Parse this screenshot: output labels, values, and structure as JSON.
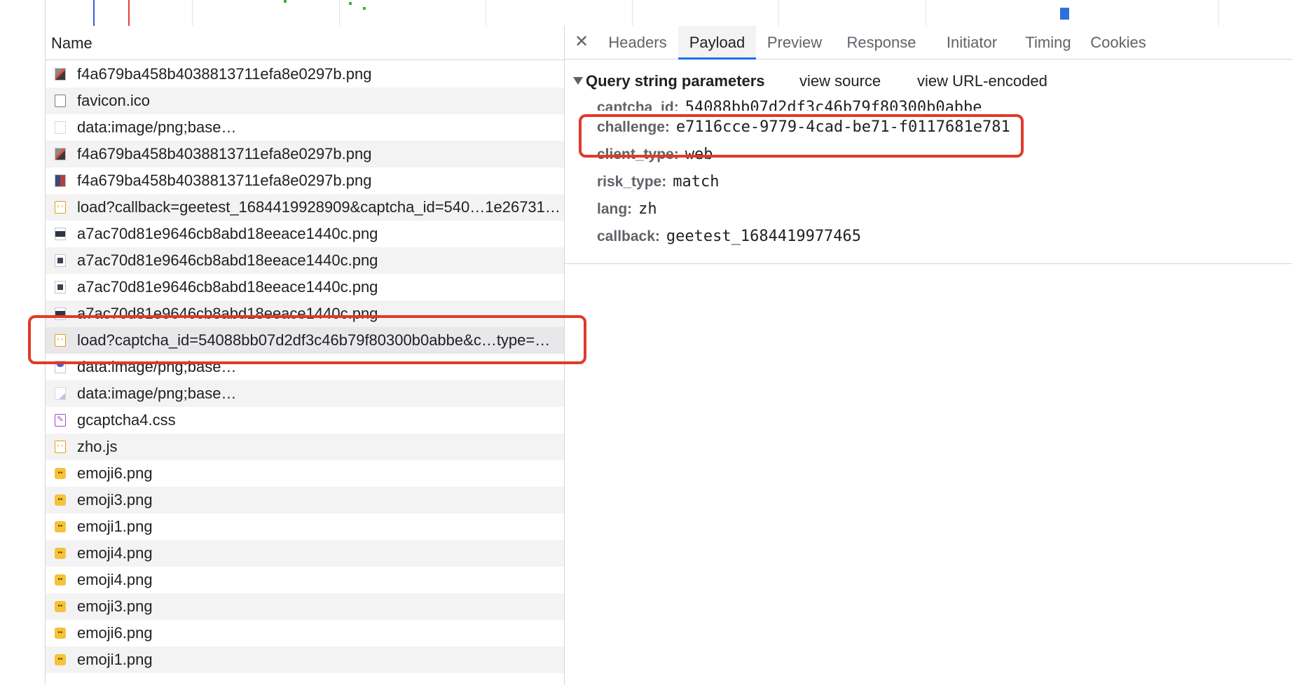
{
  "request_list": {
    "column_header": "Name",
    "rows": [
      {
        "name": "f4a679ba458b4038813711efa8e0297b.png",
        "icon": "image-icon"
      },
      {
        "name": "favicon.ico",
        "icon": "document-icon"
      },
      {
        "name": "data:image/png;base…",
        "icon": "blank-image-icon"
      },
      {
        "name": "f4a679ba458b4038813711efa8e0297b.png",
        "icon": "image-icon"
      },
      {
        "name": "f4a679ba458b4038813711efa8e0297b.png",
        "icon": "image-icon"
      },
      {
        "name": "load?callback=geetest_1684419928909&captcha_id=540…1e26731…",
        "icon": "script-icon"
      },
      {
        "name": "a7ac70d81e9646cb8abd18eeace1440c.png",
        "icon": "image-icon"
      },
      {
        "name": "a7ac70d81e9646cb8abd18eeace1440c.png",
        "icon": "image-icon"
      },
      {
        "name": "a7ac70d81e9646cb8abd18eeace1440c.png",
        "icon": "image-icon"
      },
      {
        "name": "a7ac70d81e9646cb8abd18eeace1440c.png",
        "icon": "image-icon"
      },
      {
        "name": "load?captcha_id=54088bb07d2df3c46b79f80300b0abbe&c…type=…",
        "icon": "script-icon"
      },
      {
        "name": "data:image/png;base…",
        "icon": "image-icon"
      },
      {
        "name": "data:image/png;base…",
        "icon": "image-icon"
      },
      {
        "name": "gcaptcha4.css",
        "icon": "stylesheet-icon"
      },
      {
        "name": "zho.js",
        "icon": "script-icon"
      },
      {
        "name": "emoji6.png",
        "icon": "emoji-image-icon"
      },
      {
        "name": "emoji3.png",
        "icon": "emoji-image-icon"
      },
      {
        "name": "emoji1.png",
        "icon": "emoji-image-icon"
      },
      {
        "name": "emoji4.png",
        "icon": "emoji-image-icon"
      },
      {
        "name": "emoji4.png",
        "icon": "emoji-image-icon"
      },
      {
        "name": "emoji3.png",
        "icon": "emoji-image-icon"
      },
      {
        "name": "emoji6.png",
        "icon": "emoji-image-icon"
      },
      {
        "name": "emoji1.png",
        "icon": "emoji-image-icon"
      }
    ]
  },
  "detail": {
    "close_icon": "close-icon",
    "tabs": [
      "Headers",
      "Payload",
      "Preview",
      "Response",
      "Initiator",
      "Timing",
      "Cookies"
    ],
    "active_tab": "Payload",
    "section_title": "Query string parameters",
    "view_source": "view source",
    "view_url_encoded": "view URL-encoded",
    "params": [
      {
        "key": "captcha_id:",
        "value": "54088bb07d2df3c46b79f80300b0abbe"
      },
      {
        "key": "challenge:",
        "value": "e7116cce-9779-4cad-be71-f0117681e781"
      },
      {
        "key": "client_type:",
        "value": "web"
      },
      {
        "key": "risk_type:",
        "value": "match"
      },
      {
        "key": "lang:",
        "value": "zh"
      },
      {
        "key": "callback:",
        "value": "geetest_1684419977465"
      }
    ]
  },
  "colors": {
    "annotation": "#e03a2a",
    "active_tab_underline": "#1a73e8",
    "timeline_marker_blue": "#2f6fdd",
    "timeline_marker_red": "#e0403a"
  }
}
